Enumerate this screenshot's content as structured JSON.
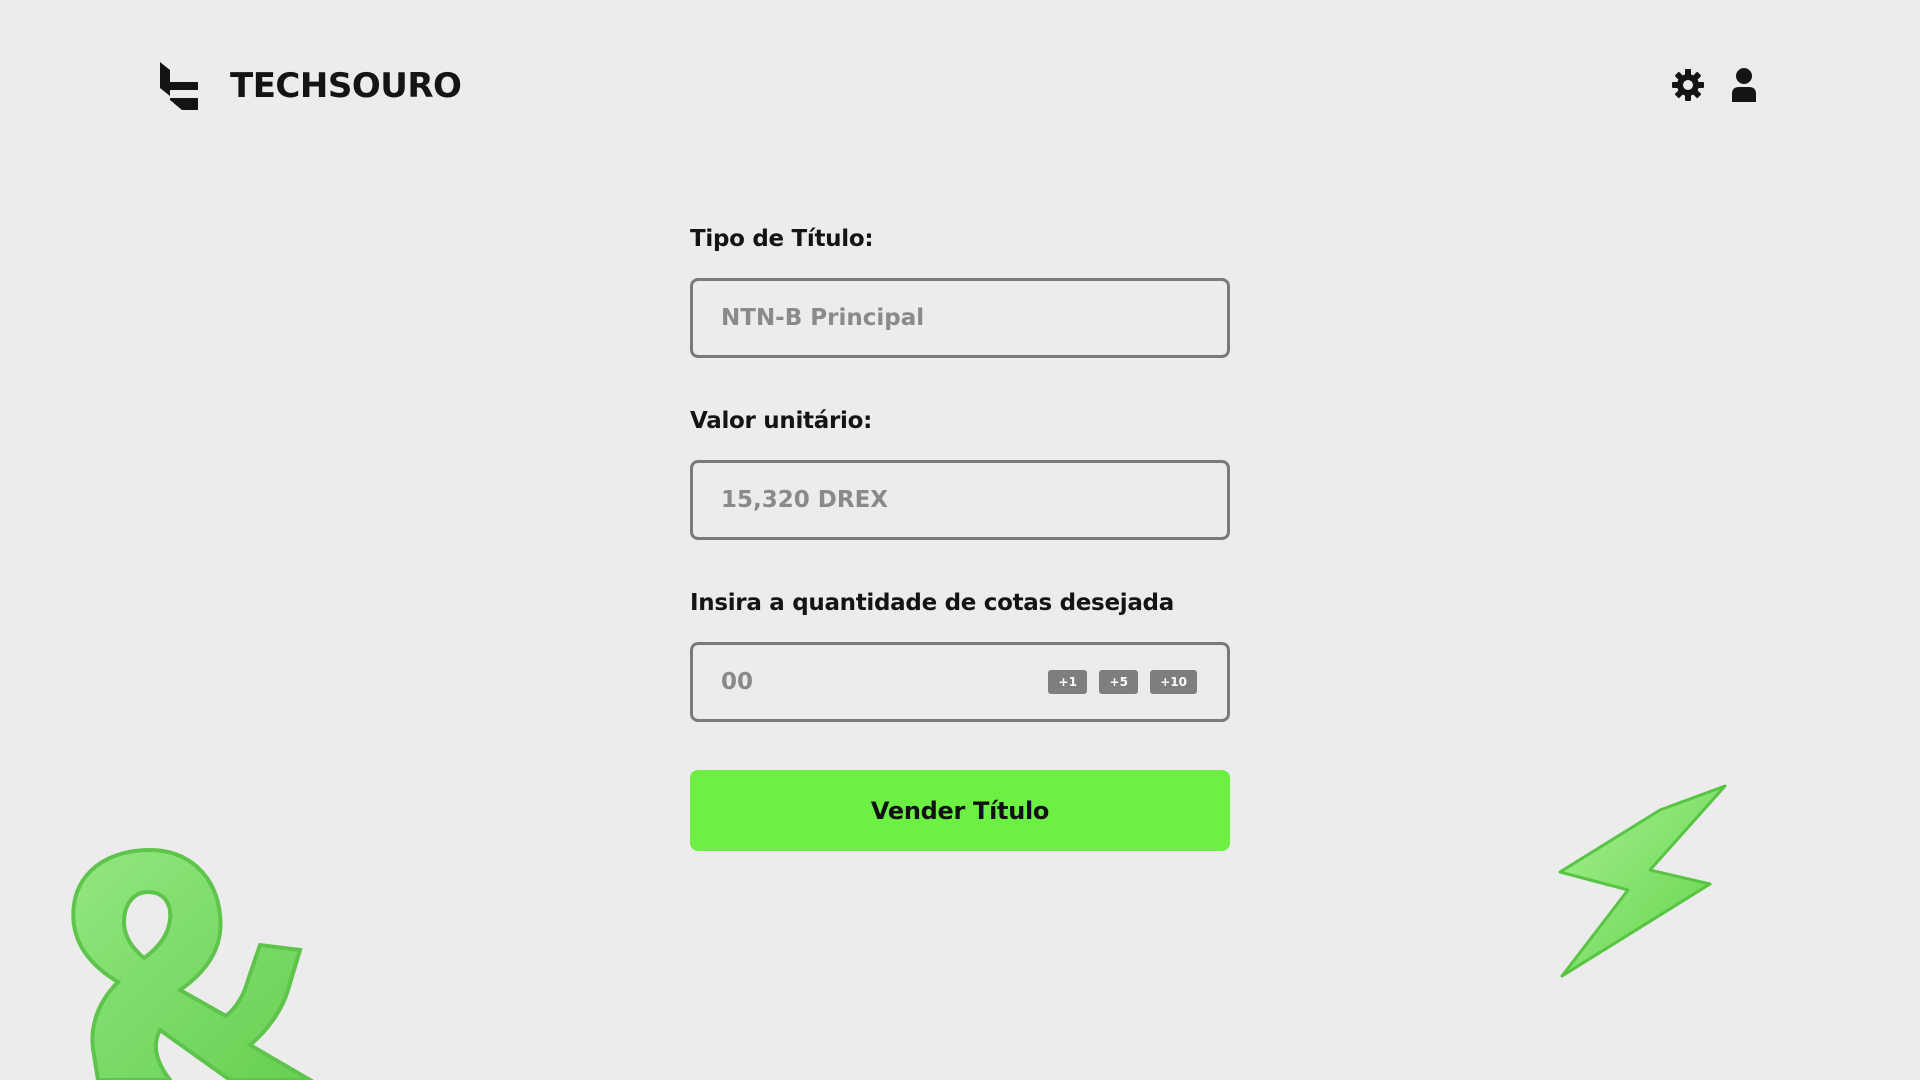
{
  "header": {
    "brand_name": "TECHSOURO",
    "settings_icon": "gear-icon",
    "profile_icon": "user-icon"
  },
  "form": {
    "title_type": {
      "label": "Tipo de Título:",
      "value": "NTN-B Principal"
    },
    "unit_value": {
      "label": "Valor unitário:",
      "value": "15,320 DREX"
    },
    "quantity": {
      "label": "Insira a quantidade de cotas desejada",
      "value": "00",
      "steps": [
        "+1",
        "+5",
        "+10"
      ]
    },
    "submit_label": "Vender Título"
  },
  "colors": {
    "background": "#ececec",
    "accent": "#6bf043",
    "field_border": "#7a7a7a",
    "step_button": "#7e7e7e"
  }
}
